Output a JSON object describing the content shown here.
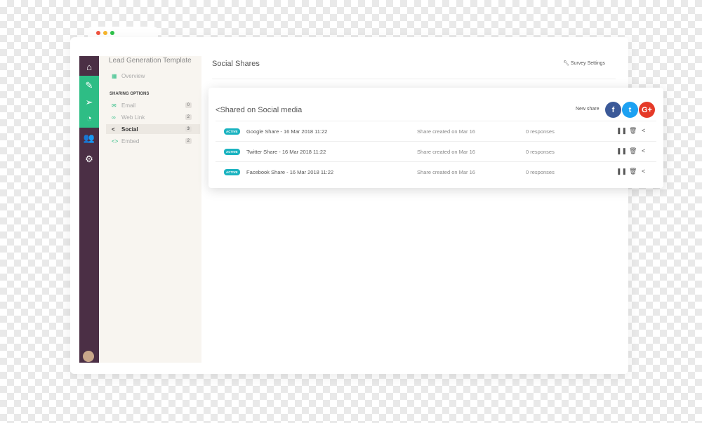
{
  "sidebar": {
    "template_title": "Lead Generation Template",
    "overview": "Overview",
    "section_label": "SHARING OPTIONS",
    "items": [
      {
        "label": "Email",
        "count": "0",
        "icon": "envelope-icon"
      },
      {
        "label": "Web Link",
        "count": "2",
        "icon": "link-icon"
      },
      {
        "label": "Social",
        "count": "3",
        "icon": "share-icon"
      },
      {
        "label": "Embed",
        "count": "2",
        "icon": "code-icon"
      }
    ]
  },
  "header": {
    "title": "Social Shares",
    "settings": "Survey Settings"
  },
  "card": {
    "title": "Shared on Social media",
    "new_share": "New share",
    "rows": [
      {
        "status": "ACTIVE",
        "name": "Google Share - 16 Mar 2018 11:22",
        "created": "Share created on Mar 16",
        "responses": "0 responses"
      },
      {
        "status": "ACTIVE",
        "name": "Twitter Share - 16 Mar 2018 11:22",
        "created": "Share created on Mar 16",
        "responses": "0 responses"
      },
      {
        "status": "ACTIVE",
        "name": "Facebook Share - 16 Mar 2018 11:22",
        "created": "Share created on Mar 16",
        "responses": "0 responses"
      }
    ]
  },
  "colors": {
    "rail": "#4b2f45",
    "accent": "#2ebd85",
    "badge": "#1bb3c0",
    "facebook": "#3b5998",
    "twitter": "#1da1f2",
    "google": "#e53a28"
  }
}
